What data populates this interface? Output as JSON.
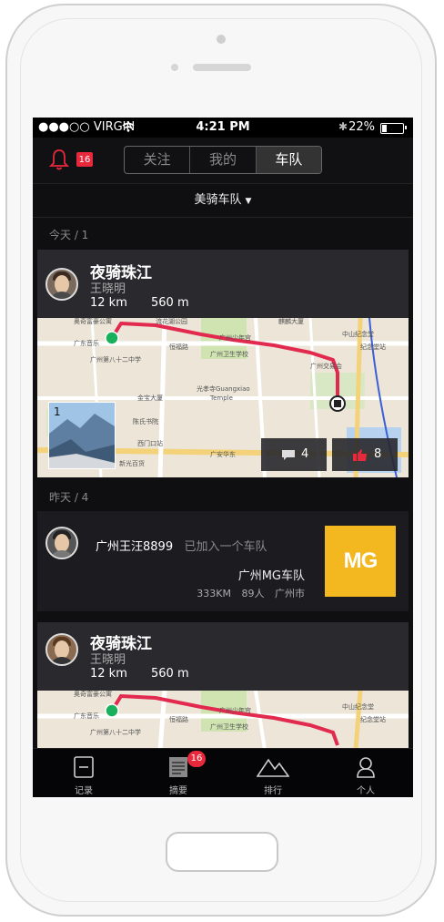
{
  "status": {
    "carrier": "●●●○○ VIRGIN",
    "time": "4:21 PM",
    "battery": "22%"
  },
  "header": {
    "notification_count": "16",
    "tabs": [
      "关注",
      "我的",
      "车队"
    ],
    "active_tab": "车队"
  },
  "team_selector": {
    "label": "美骑车队"
  },
  "sections": {
    "today": "今天 / 1",
    "yesterday": "昨天 / 4"
  },
  "ride1": {
    "title": "夜骑珠江",
    "rider": "王晓明",
    "distance": "12 km",
    "elevation": "560 m",
    "photo_count": "1",
    "comments": "4",
    "likes": "8"
  },
  "join": {
    "user": "广州王汪8899",
    "action": "已加入一个车队",
    "team_name": "广州MG车队",
    "team_km": "333KM",
    "team_members": "89人",
    "team_city": "广州市",
    "logo_text": "MG"
  },
  "ride2": {
    "title": "夜骑珠江",
    "rider": "王晓明",
    "distance": "12 km",
    "elevation": "560 m"
  },
  "map_labels": [
    "广东音乐",
    "广州第八十二中学",
    "恒福路",
    "广州卫生学校",
    "广州少年宫",
    "光孝寺Guangxiao Temple",
    "陈氏书院",
    "西门口站",
    "广安华东",
    "新光百货",
    "金宝大厦",
    "中山纪念堂",
    "纪念堂站",
    "流花湖公园",
    "广州交易会",
    "麒麟大厦",
    "广州站"
  ],
  "tabbar": {
    "items": [
      "记录",
      "摘要",
      "排行",
      "个人"
    ],
    "badge": "16"
  },
  "colors": {
    "accent": "#e8293c",
    "route": "#e2294e",
    "start": "#19b05c",
    "logo_bg": "#f3b71f"
  }
}
